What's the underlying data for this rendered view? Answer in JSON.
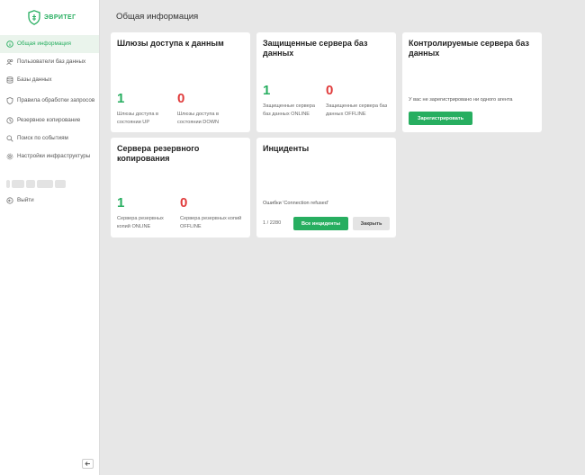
{
  "app": {
    "logo_text": "ЭВРИТЕГ"
  },
  "sidebar": {
    "items": [
      {
        "label": "Общая информация",
        "icon": "info-circle-icon"
      },
      {
        "label": "Пользователи баз данных",
        "icon": "users-icon"
      },
      {
        "label": "Базы данных",
        "icon": "database-icon"
      },
      {
        "label": "Правила обработки запросов",
        "icon": "shield-icon"
      },
      {
        "label": "Резервное копирование",
        "icon": "backup-icon"
      },
      {
        "label": "Поиск по событиям",
        "icon": "search-icon"
      },
      {
        "label": "Настройки инфраструктуры",
        "icon": "gear-icon"
      }
    ],
    "logout_label": "Выйти"
  },
  "main": {
    "title": "Общая информация",
    "cards": {
      "gateways": {
        "title": "Шлюзы доступа к данным",
        "up_value": "1",
        "up_caption": "Шлюзы доступа в состоянии UP",
        "down_value": "0",
        "down_caption": "Шлюзы доступа в состоянии DOWN"
      },
      "protected": {
        "title": "Защищенные сервера баз данных",
        "online_value": "1",
        "online_caption": "Защищенные сервера баз данных ONLINE",
        "offline_value": "0",
        "offline_caption": "Защищенные сервера баз данных OFFLINE"
      },
      "monitored": {
        "title": "Контролируемые сервера баз данных",
        "note": "У вас не зарегистрировано ни одного агента",
        "register_label": "Зарегистрировать"
      },
      "backup": {
        "title": "Сервера резервного копирования",
        "online_value": "1",
        "online_caption": "Сервера резервных копий ONLINE",
        "offline_value": "0",
        "offline_caption": "Сервера резервных копий OFFLINE"
      },
      "incidents": {
        "title": "Инциденты",
        "message": "Ошибки 'Connection refused'",
        "pager": "1 / 2280",
        "all_label": "Все инциденты",
        "close_label": "Закрыть"
      }
    }
  },
  "colors": {
    "accent": "#27ae60",
    "danger": "#e03a3a",
    "background": "#e7e7e7"
  }
}
